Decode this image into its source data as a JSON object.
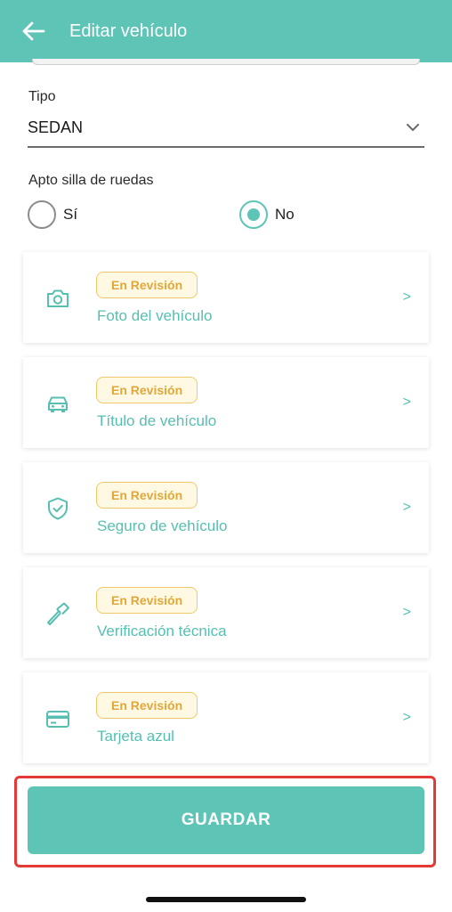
{
  "header": {
    "title": "Editar vehículo",
    "back_icon": "arrow-left-icon"
  },
  "type_field": {
    "label": "Tipo",
    "value": "SEDAN"
  },
  "wheelchair": {
    "label": "Apto silla de ruedas",
    "option_yes": "Sí",
    "option_no": "No",
    "selected": "No"
  },
  "documents": [
    {
      "status": "En Revisión",
      "title": "Foto del vehículo",
      "icon": "camera-icon",
      "arrow": ">"
    },
    {
      "status": "En Revisión",
      "title": "Título de vehículo",
      "icon": "car-icon",
      "arrow": ">"
    },
    {
      "status": "En Revisión",
      "title": "Seguro de vehículo",
      "icon": "shield-check-icon",
      "arrow": ">"
    },
    {
      "status": "En Revisión",
      "title": "Verificación técnica",
      "icon": "hammer-icon",
      "arrow": ">"
    },
    {
      "status": "En Revisión",
      "title": "Tarjeta azul",
      "icon": "credit-card-icon",
      "arrow": ">"
    }
  ],
  "save_button": {
    "label": "GUARDAR"
  },
  "colors": {
    "accent": "#5ec4b6",
    "badge_text": "#e0a83a",
    "badge_border": "#f2c96a",
    "highlight": "#e53935"
  }
}
